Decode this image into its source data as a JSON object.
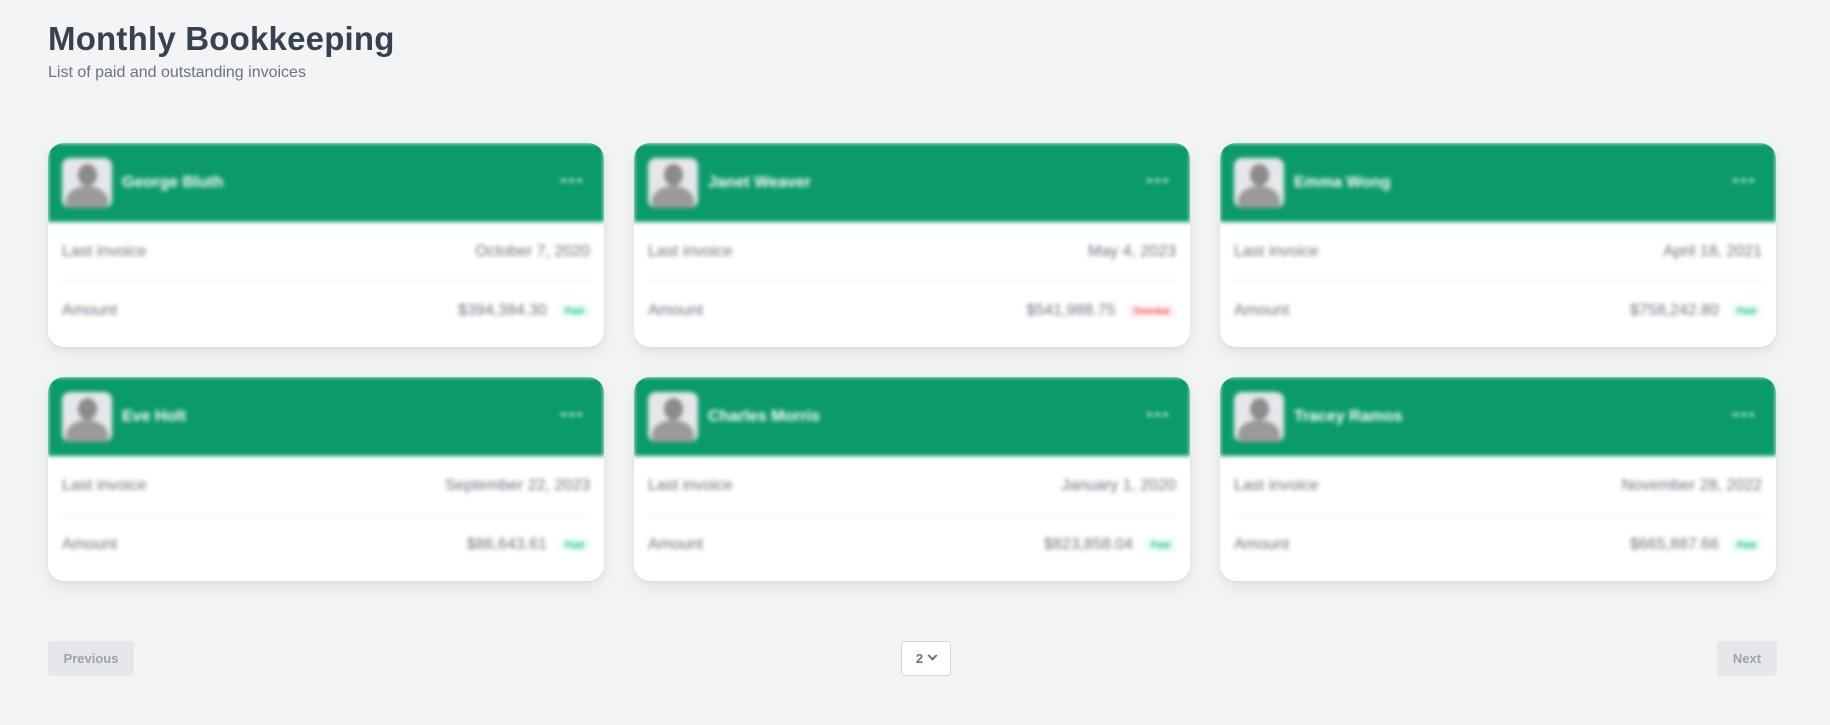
{
  "header": {
    "title": "Monthly Bookkeeping",
    "subtitle": "List of paid and outstanding invoices"
  },
  "labels": {
    "last_invoice": "Last invoice",
    "amount": "Amount"
  },
  "colors": {
    "card_header": "#0b9a6c",
    "paid": "#10b981",
    "overdue": "#ef4444"
  },
  "cards": [
    {
      "name": "George Bluth",
      "last_invoice": "October 7, 2020",
      "amount": "$394,384.30",
      "status": "Paid"
    },
    {
      "name": "Janet Weaver",
      "last_invoice": "May 4, 2023",
      "amount": "$541,988.75",
      "status": "Overdue"
    },
    {
      "name": "Emma Wong",
      "last_invoice": "April 18, 2021",
      "amount": "$758,242.80",
      "status": "Paid"
    },
    {
      "name": "Eve Holt",
      "last_invoice": "September 22, 2023",
      "amount": "$86,643.61",
      "status": "Paid"
    },
    {
      "name": "Charles Morris",
      "last_invoice": "January 1, 2020",
      "amount": "$823,858.04",
      "status": "Paid"
    },
    {
      "name": "Tracey Ramos",
      "last_invoice": "November 28, 2022",
      "amount": "$665,887.66",
      "status": "Paid"
    }
  ],
  "pagination": {
    "previous_label": "Previous",
    "next_label": "Next",
    "current_page": "2"
  }
}
